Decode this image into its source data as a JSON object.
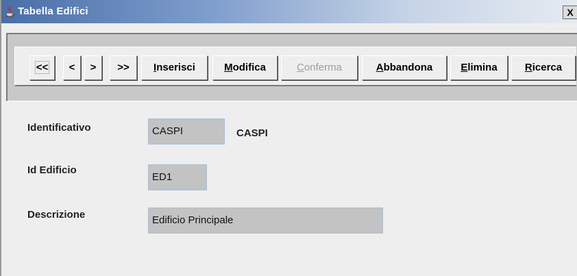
{
  "window": {
    "title": "Tabella Edifici",
    "close_label": "X"
  },
  "toolbar": {
    "buttons": [
      {
        "label": "<<",
        "underline": "",
        "rest": "<<",
        "enabled": true
      },
      {
        "label": "<",
        "underline": "",
        "rest": "<",
        "enabled": true
      },
      {
        "label": ">",
        "underline": "",
        "rest": ">",
        "enabled": true
      },
      {
        "label": ">>",
        "underline": "",
        "rest": ">>",
        "enabled": true
      },
      {
        "label": "Inserisci",
        "underline": "I",
        "rest": "nserisci",
        "enabled": true
      },
      {
        "label": "Modifica",
        "underline": "M",
        "rest": "odifica",
        "enabled": true
      },
      {
        "label": "Conferma",
        "underline": "C",
        "rest": "onferma",
        "enabled": false
      },
      {
        "label": "Abbandona",
        "underline": "A",
        "rest": "bbandona",
        "enabled": true
      },
      {
        "label": "Elimina",
        "underline": "E",
        "rest": "limina",
        "enabled": true
      },
      {
        "label": "Ricerca",
        "underline": "R",
        "rest": "icerca",
        "enabled": true
      }
    ]
  },
  "form": {
    "identificativo": {
      "label": "Identificativo",
      "value": "CASPI",
      "display": "CASPI"
    },
    "id_edificio": {
      "label": "Id Edificio",
      "value": "ED1"
    },
    "descrizione": {
      "label": "Descrizione",
      "value": "Edificio Principale"
    }
  },
  "colors": {
    "title_gradient_start": "#4a6ea8",
    "window_bg": "#eeeeee",
    "field_bg": "#c3c3c3",
    "disabled_text": "#9e9e9e"
  }
}
